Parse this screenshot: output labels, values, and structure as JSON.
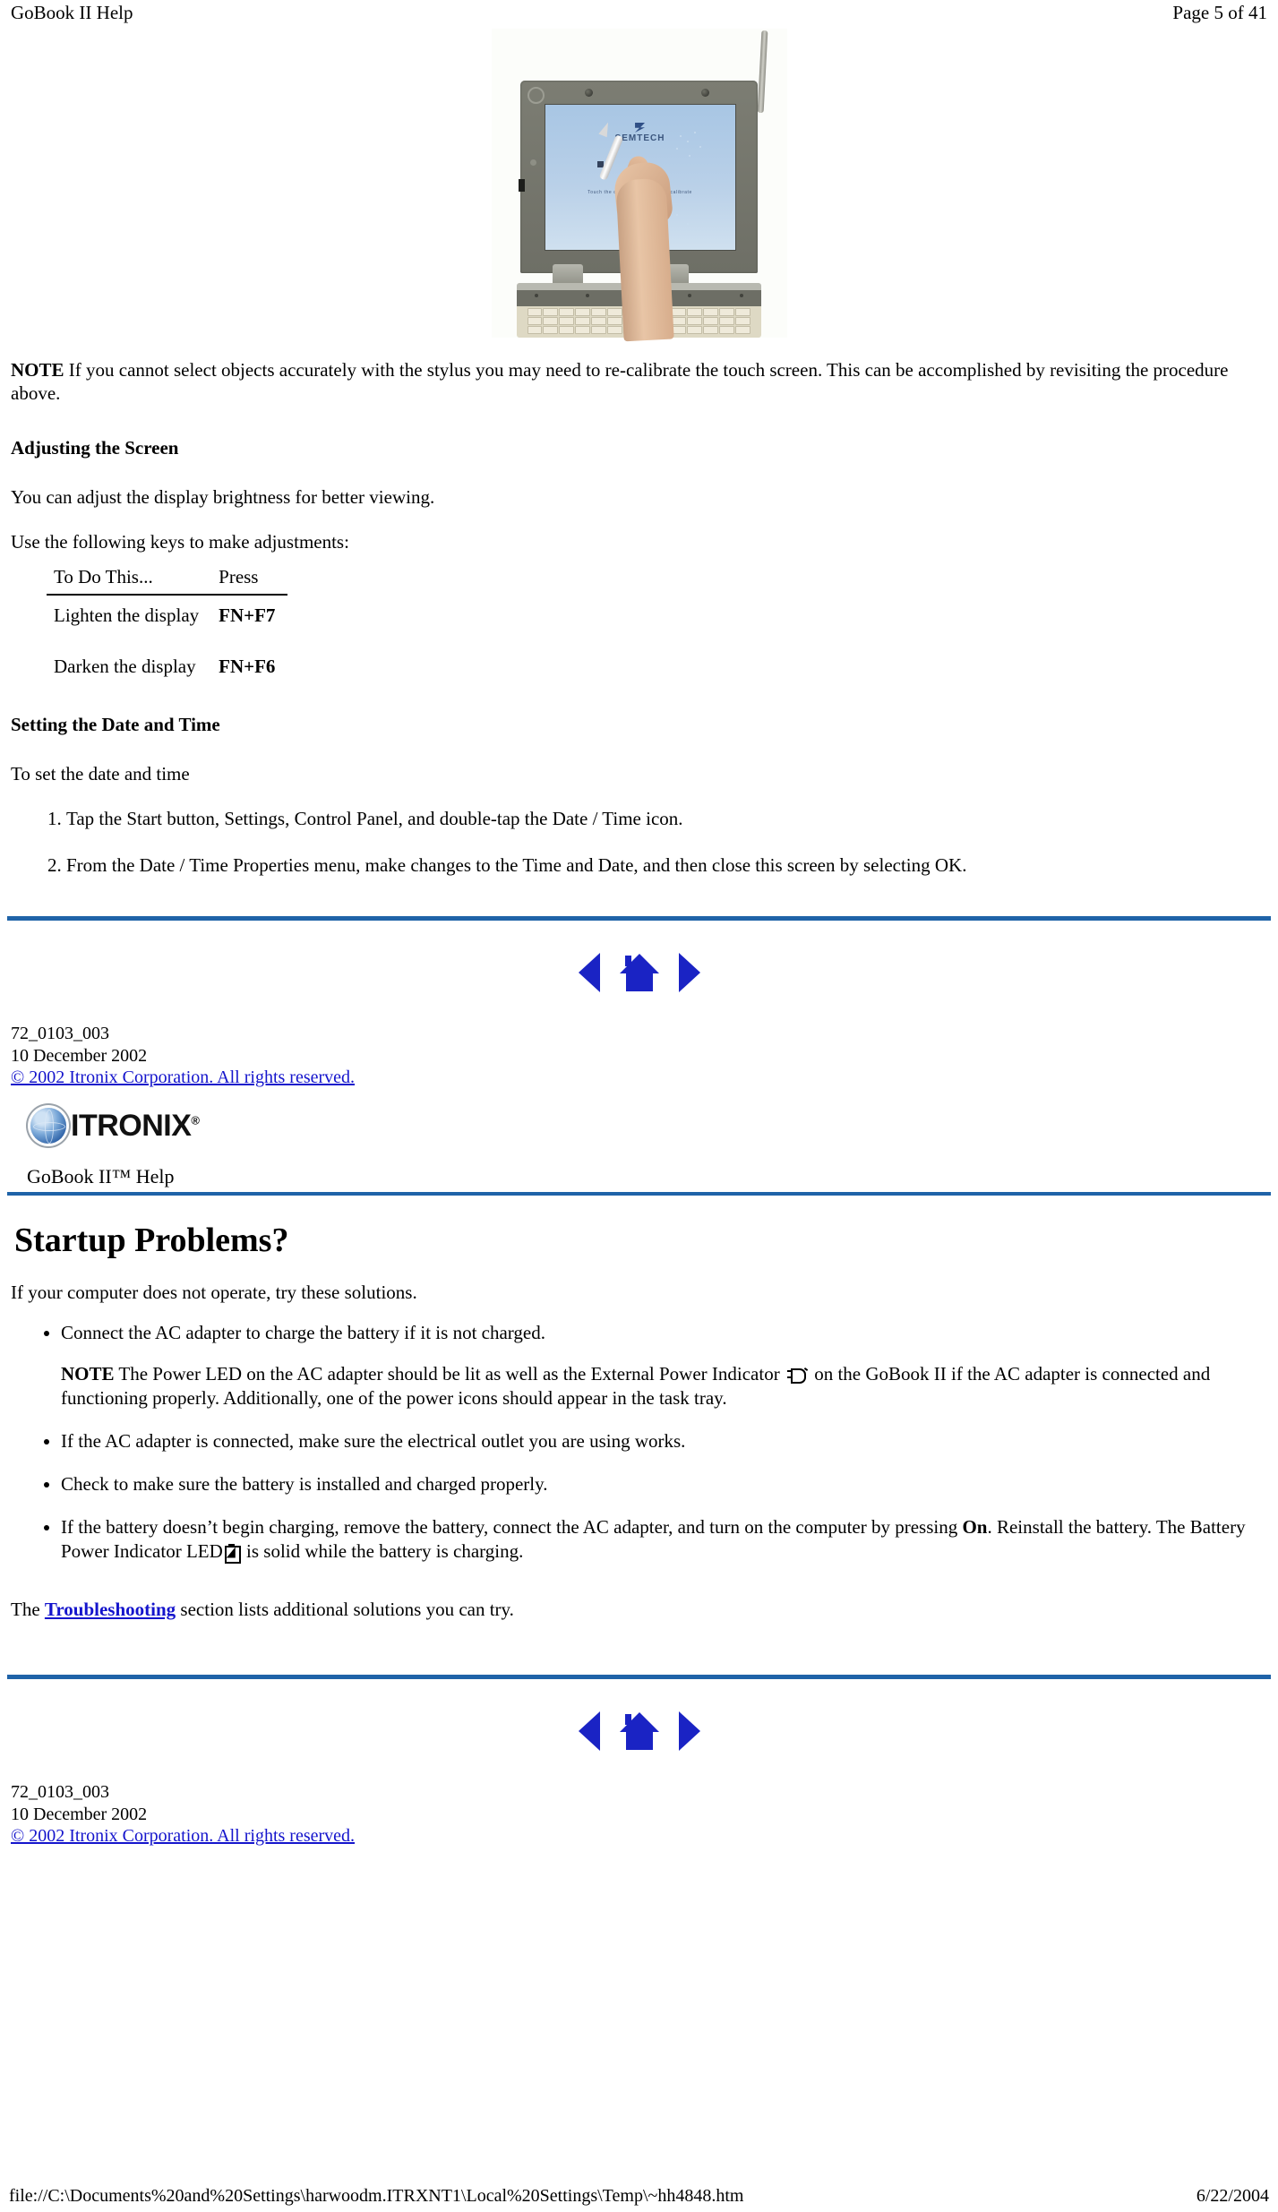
{
  "print_header": {
    "left": "GoBook II Help",
    "right": "Page 5 of 41"
  },
  "figure": {
    "alt": "Person using a stylus to tap the center of a target on the GoBook II touch screen for calibration",
    "screen_logo": "SEMTECH",
    "screen_caption": "Touch the center of the target to calibrate"
  },
  "note_calibrate": {
    "label": "NOTE",
    "text": "  If you cannot select objects accurately with the stylus you may need to re-calibrate the touch screen.  This can be accomplished by revisiting the procedure above."
  },
  "adjusting_screen": {
    "heading": "Adjusting the Screen",
    "paragraph_1": "You can adjust the display brightness for better viewing.",
    "paragraph_2": "Use the following keys to make adjustments:",
    "table": {
      "headers": [
        "To Do This...",
        "Press"
      ],
      "rows": [
        {
          "action": "Lighten  the display",
          "press": "FN+F7"
        },
        {
          "action": "Darken the display",
          "press": "FN+F6"
        }
      ]
    }
  },
  "date_time": {
    "heading": "Setting the Date and Time",
    "intro": "To set the date and time",
    "steps": [
      "Tap the Start button,  Settings, Control Panel, and double-tap the Date / Time icon.",
      "From the Date / Time Properties menu,  make changes to the Time and Date, and then close this screen by selecting OK."
    ]
  },
  "nav": {
    "back_label": "back-arrow",
    "home_label": "home",
    "forward_label": "forward-arrow"
  },
  "footer_1": {
    "doc_number": "72_0103_003",
    "date": "10 December 2002",
    "copyright": "© 2002 Itronix Corporation.  All rights reserved."
  },
  "brand": {
    "wordmark": "ITRONIX",
    "trademark": "®",
    "help_title": "GoBook II™ Help"
  },
  "startup": {
    "heading": "Startup Problems?",
    "intro": "If your computer does not operate, try these solutions.",
    "bullets": [
      {
        "text": "Connect the AC adapter to charge the battery if it is not charged.",
        "note_label": "NOTE",
        "note_part_1": " The Power LED on the AC adapter should be lit as well as the External Power Indicator ",
        "note_icon": "external-power-icon",
        "note_part_2": " on the GoBook II if the AC adapter is connected and functioning properly. Additionally, one of the power icons should appear in the task tray."
      },
      {
        "text": "If the AC adapter is connected, make sure the electrical outlet you are using works."
      },
      {
        "text": "Check to make sure the battery is installed and charged properly."
      },
      {
        "part_1": "If the battery doesn’t begin charging, remove the battery, connect the AC adapter, and turn on the computer by pressing ",
        "emphasis": "On",
        "part_2": ". Reinstall the battery. The Battery Power Indicator LED",
        "icon": "battery-icon",
        "part_3": "  is solid while the battery is charging."
      }
    ],
    "closing_prefix": "The ",
    "closing_link": "Troubleshooting",
    "closing_suffix": " section lists additional solutions you can try."
  },
  "footer_2": {
    "doc_number": "72_0103_003",
    "date": "10 December 2002",
    "copyright": "© 2002 Itronix Corporation.  All rights reserved."
  },
  "status_bar": {
    "path": "file://C:\\Documents%20and%20Settings\\harwoodm.ITRXNT1\\Local%20Settings\\Temp\\~hh4848.htm",
    "date": "6/22/2004"
  },
  "colors": {
    "rule_blue": "#1f63a8",
    "link_blue": "#1414cc",
    "nav_blue": "#1a23c4"
  }
}
